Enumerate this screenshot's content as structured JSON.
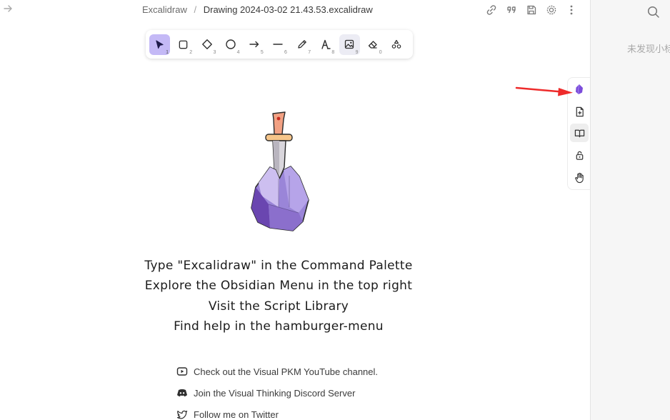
{
  "header": {
    "breadcrumb_parent": "Excalidraw",
    "breadcrumb_separator": "/",
    "file_title": "Drawing 2024-03-02 21.43.53.excalidraw"
  },
  "toolbar": {
    "tools": [
      {
        "name": "selection",
        "key": "1"
      },
      {
        "name": "rectangle",
        "key": "2"
      },
      {
        "name": "diamond",
        "key": "3"
      },
      {
        "name": "ellipse",
        "key": "4"
      },
      {
        "name": "arrow",
        "key": "5"
      },
      {
        "name": "line",
        "key": "6"
      },
      {
        "name": "draw",
        "key": "7"
      },
      {
        "name": "text",
        "key": "8"
      },
      {
        "name": "image",
        "key": "9"
      },
      {
        "name": "eraser",
        "key": "0"
      }
    ]
  },
  "canvas": {
    "welcome_lines": [
      "Type \"Excalidraw\" in the Command Palette",
      "Explore the Obsidian Menu in the top right",
      "Visit the Script Library",
      "Find help in the hamburger-menu"
    ],
    "links": [
      {
        "label": "Check out the Visual PKM YouTube channel.",
        "icon": "youtube-icon"
      },
      {
        "label": "Join the Visual Thinking Discord Server",
        "icon": "discord-icon"
      },
      {
        "label": "Follow me on Twitter",
        "icon": "twitter-icon"
      }
    ]
  },
  "right_panel": {
    "empty_text": "未发现小标题"
  },
  "colors": {
    "accent": "#c4b9f6",
    "obsidian_purple": "#7c4ddb",
    "annotation_arrow": "#ee2b2b"
  }
}
